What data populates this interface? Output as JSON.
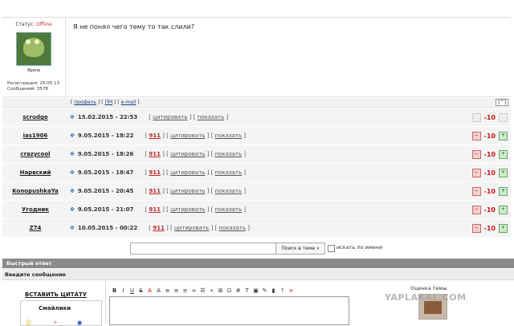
{
  "post": {
    "status_label": "Статус:",
    "status_value": "Offline",
    "user_name": "Ярила",
    "reg_label": "Регистрация: 25.05.13",
    "msgs_label": "Сообщений: 3578",
    "body": "Я не понял чего тему то так слили?"
  },
  "post_links": {
    "profile": "профиль",
    "pm": "ПМ",
    "email": "e-mail",
    "up": "[^]"
  },
  "rows": [
    {
      "name": "scrudge",
      "date": "15.02.2015 - 22:53",
      "has911": false,
      "quote": "цитировать",
      "show": "показать",
      "score": "-10",
      "style": "plain"
    },
    {
      "name": "ias1906",
      "date": "9.05.2015 - 18:22",
      "has911": true,
      "quote": "цитировать",
      "show": "показать",
      "score": "-10",
      "style": "vote"
    },
    {
      "name": "crazycool",
      "date": "9.05.2015 - 18:26",
      "has911": true,
      "quote": "цитировать",
      "show": "показать",
      "score": "-10",
      "style": "vote"
    },
    {
      "name": "Нарвский",
      "date": "9.05.2015 - 18:47",
      "has911": true,
      "quote": "цитировать",
      "show": "показать",
      "score": "-10",
      "style": "vote"
    },
    {
      "name": "KonopushkaYa",
      "date": "9.05.2015 - 20:45",
      "has911": true,
      "quote": "цитировать",
      "show": "показать",
      "score": "-10",
      "style": "vote"
    },
    {
      "name": "Угодник",
      "date": "9.05.2015 - 21:07",
      "has911": true,
      "quote": "цитировать",
      "show": "показать",
      "score": "-10",
      "style": "vote"
    },
    {
      "name": "Z74",
      "date": "10.05.2015 - 00:22",
      "has911": true,
      "quote": "цитировать",
      "show": "показать",
      "score": "-10",
      "style": "vote"
    }
  ],
  "tag911": "911",
  "search": {
    "button": "Поиск в теме »",
    "checkbox_label": "искать по имени"
  },
  "quick_reply": {
    "title": "Быстрый ответ",
    "enter_message": "Введите сообщение",
    "insert_quote": "ВСТАВИТЬ ЦИТАТУ",
    "smileys": "Смайлики",
    "rating": "Оценка темы"
  },
  "watermark": "YAPLAKAL.COM",
  "colors": {
    "score": "#d01818",
    "tag911": "#c0282a",
    "status_offline": "#c43a2a",
    "quick_reply_bar": "#8a8a8a"
  }
}
